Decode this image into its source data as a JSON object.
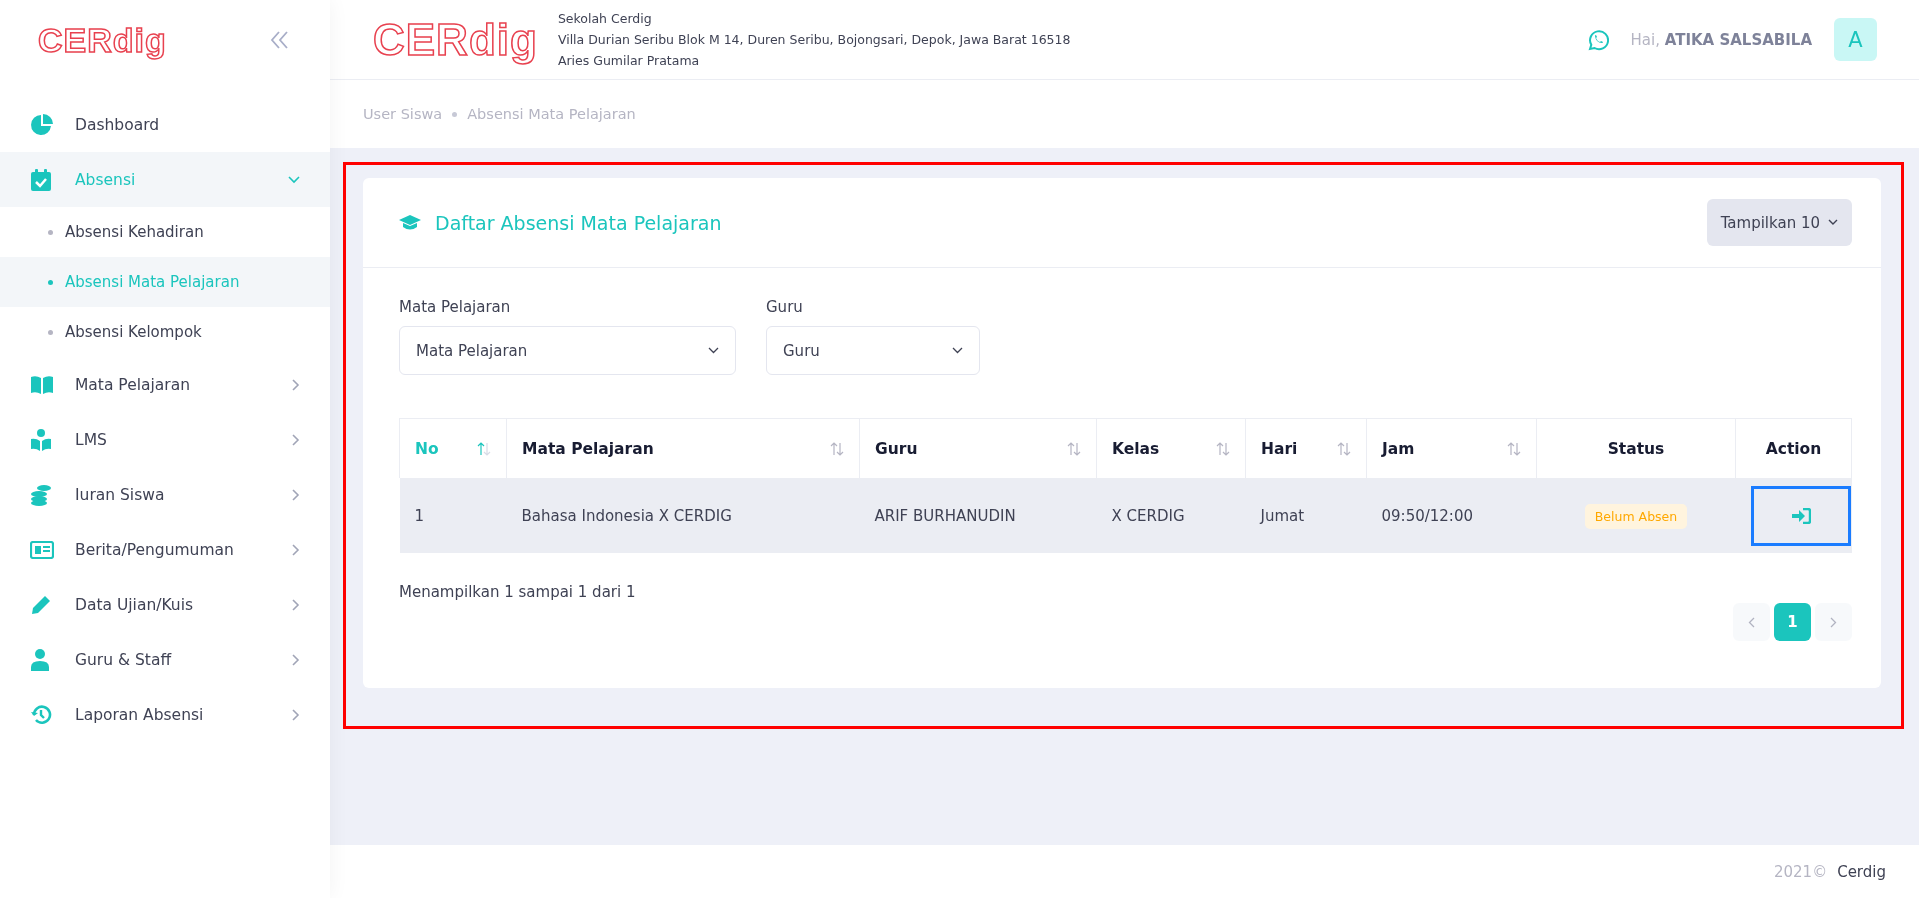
{
  "sidebar": {
    "logo": "CERdig",
    "items": [
      {
        "label": "Dashboard",
        "kind": "link",
        "selected": false
      },
      {
        "label": "Absensi",
        "kind": "group",
        "selected": true,
        "expanded": true,
        "children": [
          {
            "label": "Absensi Kehadiran",
            "selected": false
          },
          {
            "label": "Absensi Mata Pelajaran",
            "selected": true
          },
          {
            "label": "Absensi Kelompok",
            "selected": false
          }
        ]
      },
      {
        "label": "Mata Pelajaran",
        "kind": "group",
        "selected": false,
        "expanded": false
      },
      {
        "label": "LMS",
        "kind": "group",
        "selected": false,
        "expanded": false
      },
      {
        "label": "Iuran Siswa",
        "kind": "group",
        "selected": false,
        "expanded": false
      },
      {
        "label": "Berita/Pengumuman",
        "kind": "group",
        "selected": false,
        "expanded": false
      },
      {
        "label": "Data Ujian/Kuis",
        "kind": "group",
        "selected": false,
        "expanded": false
      },
      {
        "label": "Guru & Staff",
        "kind": "group",
        "selected": false,
        "expanded": false
      },
      {
        "label": "Laporan Absensi",
        "kind": "group",
        "selected": false,
        "expanded": false
      }
    ]
  },
  "header": {
    "logo": "CERdig",
    "school_name": "Sekolah Cerdig",
    "address": "Villa Durian Seribu Blok M 14, Duren Seribu, Bojongsari, Depok, Jawa Barat 16518",
    "principal": "Aries Gumilar Pratama",
    "greeting": "Hai,",
    "user_name": "ATIKA SALSABILA",
    "avatar": "A"
  },
  "breadcrumb": [
    "User Siswa",
    "Absensi Mata Pelajaran"
  ],
  "card": {
    "title": "Daftar Absensi Mata Pelajaran",
    "page_size_button": "Tampilkan 10",
    "filters": [
      {
        "label": "Mata Pelajaran",
        "value": "Mata Pelajaran"
      },
      {
        "label": "Guru",
        "value": "Guru"
      }
    ],
    "table": {
      "columns": [
        {
          "label": "No",
          "kind": "sortable",
          "sorted": true
        },
        {
          "label": "Mata Pelajaran",
          "kind": "sortable",
          "sorted": false
        },
        {
          "label": "Guru",
          "kind": "sortable",
          "sorted": false
        },
        {
          "label": "Kelas",
          "kind": "sortable",
          "sorted": false
        },
        {
          "label": "Hari",
          "kind": "sortable",
          "sorted": false
        },
        {
          "label": "Jam",
          "kind": "sortable",
          "sorted": false
        },
        {
          "label": "Status",
          "kind": "plain"
        },
        {
          "label": "Action",
          "kind": "plain"
        }
      ],
      "rows": [
        {
          "cells": [
            "1",
            "Bahasa Indonesia X CERDIG",
            "ARIF BURHANUDIN",
            "X CERDIG",
            "Jumat",
            "09:50/12:00"
          ],
          "status": "Belum Absen",
          "annotated": true
        }
      ]
    },
    "summary": "Menampilkan 1 sampai 1 dari 1",
    "pagination": {
      "prev_disabled": true,
      "next_disabled": true,
      "pages": [
        {
          "label": "1",
          "selected": true
        }
      ]
    }
  },
  "annotated": true,
  "footer": {
    "year": "2021©",
    "brand": "Cerdig"
  }
}
